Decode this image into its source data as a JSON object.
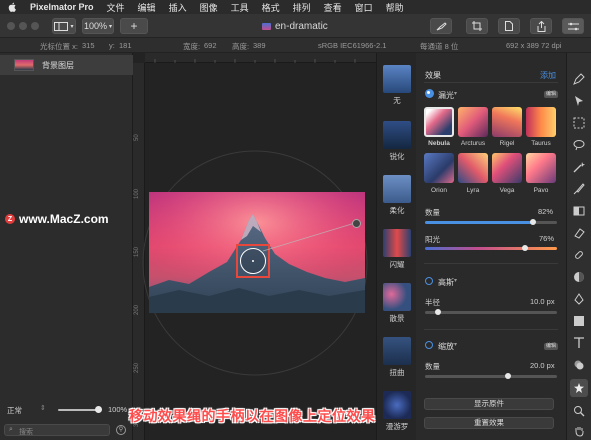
{
  "menubar": {
    "app_name": "Pixelmator Pro",
    "items": [
      "文件",
      "编辑",
      "插入",
      "图像",
      "工具",
      "格式",
      "排列",
      "查看",
      "窗口",
      "帮助"
    ]
  },
  "toolbar": {
    "zoom": "100%",
    "add": "+",
    "doc_title": "en-dramatic"
  },
  "infobar": {
    "cursor_label": "光标位置 x:",
    "cursor_x": "315",
    "y_label": "y:",
    "cursor_y": "181",
    "width_label": "宽度:",
    "width": "692",
    "height_label": "高度:",
    "height": "389",
    "color_profile": "sRGB IEC61966-2.1",
    "bit_depth": "每通道 8 位",
    "dimensions": "692 x 389 72 dpi"
  },
  "layers": {
    "layer_name": "背景图层",
    "blend_mode": "正常",
    "opacity": "100%",
    "opacity_value": 1.0,
    "search_placeholder": "搜索"
  },
  "ruler_marks": [
    "50",
    "100",
    "150",
    "200",
    "250",
    "300"
  ],
  "effects_browser": [
    "无",
    "锐化",
    "柔化",
    "闪耀",
    "散景",
    "扭曲",
    "漫游罗"
  ],
  "effects_panel": {
    "title": "效果",
    "add": "添加",
    "light_leak": {
      "name": "漏光",
      "badge": "编辑",
      "presets": [
        "Nebula",
        "Arcturus",
        "Rigel",
        "Taurus",
        "Orion",
        "Lyra",
        "Vega",
        "Pavo"
      ],
      "amount_label": "数量",
      "amount": "82%",
      "amount_value": 0.82,
      "sun_label": "阳光",
      "sun": "76%",
      "sun_value": 0.76
    },
    "gaussian": {
      "name": "高斯",
      "radius_label": "半径",
      "radius": "10.0 px",
      "radius_value": 0.1
    },
    "zoom_blur": {
      "name": "缩放",
      "badge": "编辑",
      "amount_label": "数量",
      "amount": "20.0 px",
      "amount_value": 0.63
    },
    "show_original": "显示原件",
    "reset": "重置效果"
  },
  "watermark": {
    "logo": "Z",
    "text": "www.MacZ.com"
  },
  "caption": "移动效果绳的手柄以在图像上定位效果",
  "colors": {
    "accent": "#4a90e2",
    "caption": "#ff4d4d"
  }
}
